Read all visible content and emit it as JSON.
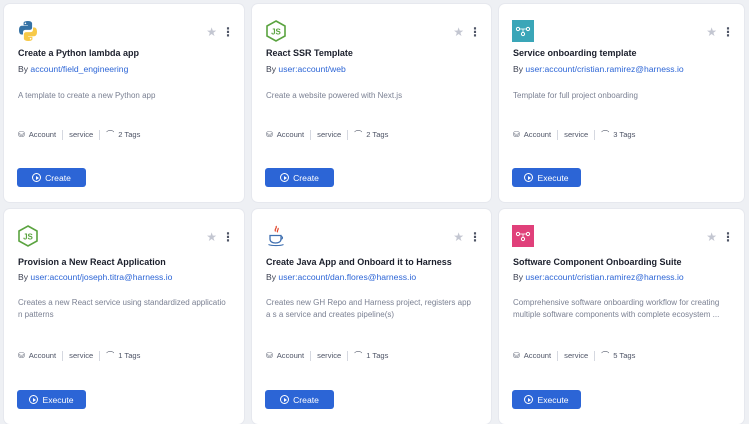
{
  "cards": [
    {
      "logo": "python-logo",
      "title": "Create a Python lambda app",
      "by_prefix": "By ",
      "owner": "account/field_engineering",
      "description": "A template to create a new Python app",
      "scope": "Account",
      "kind": "service",
      "tags": "2 Tags",
      "button": "Create"
    },
    {
      "logo": "nodejs-logo",
      "title": "React SSR Template",
      "by_prefix": "By ",
      "owner": "user:account/web",
      "description": "Create a website powered with Next.js",
      "scope": "Account",
      "kind": "service",
      "tags": "2 Tags",
      "button": "Create"
    },
    {
      "logo": "service-logo-teal",
      "title": "Service onboarding template",
      "by_prefix": "By ",
      "owner": "user:account/cristian.ramirez@harness.io",
      "description": "Template for full project onboarding",
      "scope": "Account",
      "kind": "service",
      "tags": "3 Tags",
      "button": "Execute"
    },
    {
      "logo": "nodejs-logo",
      "title": "Provision a New React Application",
      "by_prefix": "By ",
      "owner": "user:account/joseph.titra@harness.io",
      "description": "Creates a new React service using standardized applicatio n patterns",
      "scope": "Account",
      "kind": "service",
      "tags": "1 Tags",
      "button": "Execute"
    },
    {
      "logo": "java-logo",
      "title": "Create Java App and Onboard it to Harness",
      "by_prefix": "By ",
      "owner": "user:account/dan.flores@harness.io",
      "description": "Creates new GH Repo and Harness project, registers app a s a service and creates pipeline(s)",
      "scope": "Account",
      "kind": "service",
      "tags": "1 Tags",
      "button": "Create"
    },
    {
      "logo": "service-logo-pink",
      "title": "Software Component Onboarding Suite",
      "by_prefix": "By ",
      "owner": "user:account/cristian.ramirez@harness.io",
      "description": "Comprehensive software onboarding workflow for creating multiple software components with complete ecosystem ...",
      "scope": "Account",
      "kind": "service",
      "tags": "5 Tags",
      "button": "Execute"
    }
  ],
  "icons": {
    "favorite": "star-icon",
    "menu": "more-vertical-icon",
    "scope": "account-icon",
    "tags": "tag-icon",
    "button": "play-circle-icon"
  },
  "colors": {
    "primary": "#2c65d6",
    "python_blue": "#3572a5",
    "python_yellow": "#f7c948",
    "node_green": "#5aa33f",
    "teal": "#3aa6b8",
    "pink": "#e0407a",
    "java_red": "#e2462b",
    "java_blue": "#3f6fb0"
  }
}
